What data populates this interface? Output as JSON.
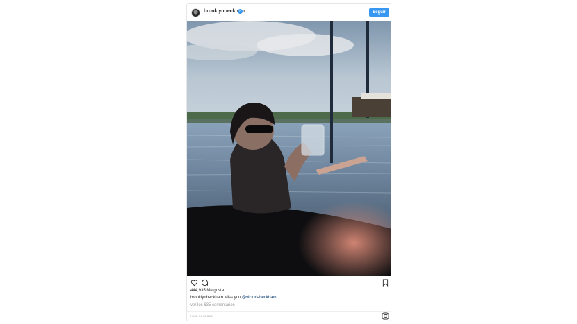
{
  "post": {
    "username": "brooklynbeckham",
    "verified": true,
    "follow_label": "Seguir",
    "likes_text": "444,935 Me gusta",
    "caption_user": "brooklynbeckham",
    "caption_text": "Miss you",
    "caption_mention": "@victoriabeckham",
    "view_comments": "ver los 635 comentarios",
    "timestamp": "HACE 29 HORAS"
  },
  "icons": {
    "like": "heart-icon",
    "comment": "comment-icon",
    "save": "bookmark-icon",
    "embed_brand": "instagram-icon",
    "verified": "verified-badge-icon"
  },
  "colors": {
    "accent": "#3897f0",
    "text": "#262626",
    "muted": "#999999",
    "border": "#e6e6e6"
  }
}
